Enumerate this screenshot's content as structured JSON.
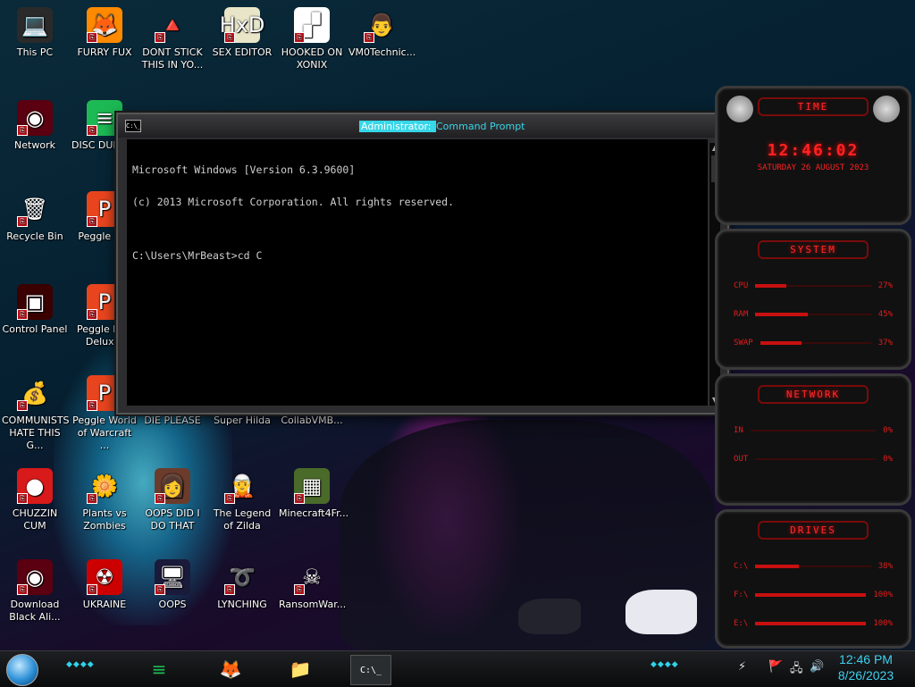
{
  "desktop": {
    "icons": [
      {
        "label": "This PC",
        "glyph": "💻",
        "bg": "#2a2a2a"
      },
      {
        "label": "FURRY FUX",
        "glyph": "🦊",
        "bg": "#ff8a00"
      },
      {
        "label": "DONT STICK THIS IN YO...",
        "glyph": "🔺",
        "bg": "transparent"
      },
      {
        "label": "SEX EDITOR",
        "glyph": "HxD",
        "bg": "#e9e5c8"
      },
      {
        "label": "HOOKED ON XONIX",
        "glyph": "▞",
        "bg": "#fff"
      },
      {
        "label": "VM0Technic...",
        "glyph": "👨",
        "bg": "transparent"
      },
      {
        "label": "Network",
        "glyph": "◉",
        "bg": "#5a0010"
      },
      {
        "label": "DISC DUMB...",
        "glyph": "≡",
        "bg": "#1db954"
      },
      {
        "label": "Recycle Bin",
        "glyph": "🗑",
        "bg": "transparent"
      },
      {
        "label": "Peggle D...",
        "glyph": "P",
        "bg": "#e8451e"
      },
      {
        "label": "Control Panel",
        "glyph": "▣",
        "bg": "#3a0000"
      },
      {
        "label": "Peggle Ni... Delux...",
        "glyph": "P",
        "bg": "#e8451e"
      },
      {
        "label": "COMMUNISTS HATE THIS G...",
        "glyph": "💰",
        "bg": "transparent"
      },
      {
        "label": "Peggle World of Warcraft ...",
        "glyph": "P",
        "bg": "#e8451e"
      },
      {
        "label": "DIE PLEASE",
        "glyph": "",
        "bg": "transparent"
      },
      {
        "label": "Super Hilda",
        "glyph": "",
        "bg": "transparent"
      },
      {
        "label": "CollabVMB...",
        "glyph": "",
        "bg": "transparent"
      },
      {
        "label": "CHUZZIN CUM",
        "glyph": "●",
        "bg": "#d81a1a"
      },
      {
        "label": "Plants vs Zombies",
        "glyph": "🌼",
        "bg": "transparent"
      },
      {
        "label": "OOPS DID I DO THAT",
        "glyph": "👩",
        "bg": "#6b3b2b"
      },
      {
        "label": "The Legend of Zilda",
        "glyph": "🧝",
        "bg": "transparent"
      },
      {
        "label": "Minecraft4Fr...",
        "glyph": "▦",
        "bg": "#4a6a2a"
      },
      {
        "label": "Download Black Ali...",
        "glyph": "◉",
        "bg": "#5a0010"
      },
      {
        "label": "UKRAINE",
        "glyph": "☢",
        "bg": "#c00"
      },
      {
        "label": "OOPS",
        "glyph": "🖥",
        "bg": "#1a1a3a"
      },
      {
        "label": "LYNCHING",
        "glyph": "➰",
        "bg": "transparent"
      },
      {
        "label": "RansomWar...",
        "glyph": "☠",
        "bg": "transparent"
      }
    ]
  },
  "cmd": {
    "title_prefix": "Administrator: ",
    "title": "Command Prompt",
    "icon_text": "C:\\_",
    "lines": [
      "Microsoft Windows [Version 6.3.9600]",
      "(c) 2013 Microsoft Corporation. All rights reserved.",
      "",
      "C:\\Users\\MrBeast>cd C"
    ]
  },
  "gadgets": {
    "time": {
      "header": "TIME",
      "time": "12:46:02",
      "date": "SATURDAY 26 AUGUST 2023"
    },
    "system": {
      "header": "SYSTEM",
      "rows": [
        {
          "label": "CPU",
          "value": "27%",
          "level": 0.27
        },
        {
          "label": "RAM",
          "value": "45%",
          "level": 0.45
        },
        {
          "label": "SWAP",
          "value": "37%",
          "level": 0.37
        }
      ]
    },
    "network": {
      "header": "NETWORK",
      "rows": [
        {
          "label": "IN",
          "value": "0%",
          "level": 0.0
        },
        {
          "label": "OUT",
          "value": "0%",
          "level": 0.0
        }
      ]
    },
    "drives": {
      "header": "DRIVES",
      "rows": [
        {
          "label": "C:\\",
          "value": "38%",
          "level": 0.38
        },
        {
          "label": "F:\\",
          "value": "100%",
          "level": 1.0
        },
        {
          "label": "E:\\",
          "value": "100%",
          "level": 1.0
        }
      ]
    }
  },
  "taskbar": {
    "apps": [
      {
        "name": "spotify",
        "glyph": "≡",
        "color": "#1db954"
      },
      {
        "name": "firefox",
        "glyph": "🦊",
        "color": "#ff8a00"
      },
      {
        "name": "file-explorer",
        "glyph": "📁",
        "color": "#f3c13a"
      },
      {
        "name": "command-prompt",
        "glyph": "C:\\_",
        "color": "#fff"
      }
    ],
    "tray_icons": [
      "⚡",
      "🚩",
      "🖧",
      "🔊"
    ],
    "clock_time": "12:46 PM",
    "clock_date": "8/26/2023"
  }
}
